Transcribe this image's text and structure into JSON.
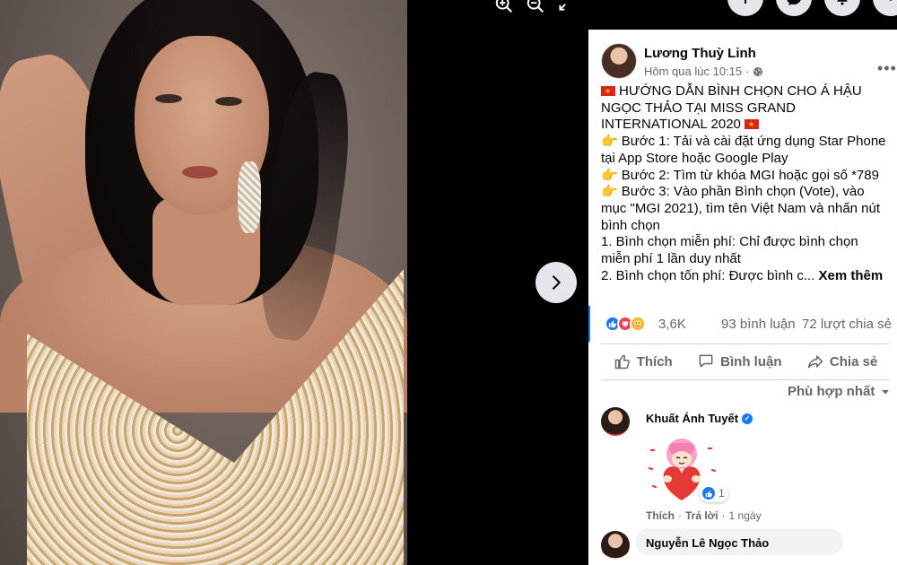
{
  "viewer": {
    "icons": [
      "zoom-in-icon",
      "zoom-out-icon",
      "fullscreen-icon"
    ],
    "next_icon": "chevron-right-icon"
  },
  "top_actions": [
    "plus-icon",
    "messenger-icon",
    "bell-icon",
    "chevron-down-icon"
  ],
  "post": {
    "author": "Lương Thuỳ Linh",
    "time": "Hôm qua lúc 10:15",
    "privacy_icon": "globe-icon",
    "more_icon": "more-options-icon",
    "text": {
      "line1": "HƯỚNG DẪN BÌNH CHỌN CHO Á HẬU NGỌC THẢO TẠI MISS GRAND INTERNATIONAL 2020",
      "step1": "Bước 1: Tải và cài đặt ứng dụng Star Phone tại App Store hoặc Google Play",
      "step2": "Bước 2: Tìm từ khóa MGI hoặc gọi số *789",
      "step3": "Bước 3: Vào phần Bình chọn (Vote), vào mục \"MGI 2021), tìm tên Việt Nam và nhấn nút bình chọn",
      "item1": "1. Bình chọn miễn phí: Chỉ được bình chọn miễn phí 1 lần duy nhất",
      "item2": "2. Bình chọn tốn phí: Được bình c...",
      "see_more": "Xem thêm"
    },
    "reactions": {
      "count": "3,6K",
      "comments": "93 bình luận",
      "shares": "72 lượt chia sẻ"
    },
    "actions": {
      "like": "Thích",
      "comment": "Bình luận",
      "share": "Chia sẻ"
    },
    "sort_label": "Phù hợp nhất"
  },
  "comments": [
    {
      "name": "Khuất Ánh Tuyết",
      "verified": true,
      "sticker_likes": "1",
      "like": "Thích",
      "reply": "Trả lời",
      "time": "1 ngày"
    },
    {
      "name": "Nguyễn Lê Ngọc Thảo"
    }
  ],
  "colors": {
    "accent": "#1877f2",
    "text": "#050505",
    "muted": "#65676b",
    "love": "#f33e58"
  }
}
